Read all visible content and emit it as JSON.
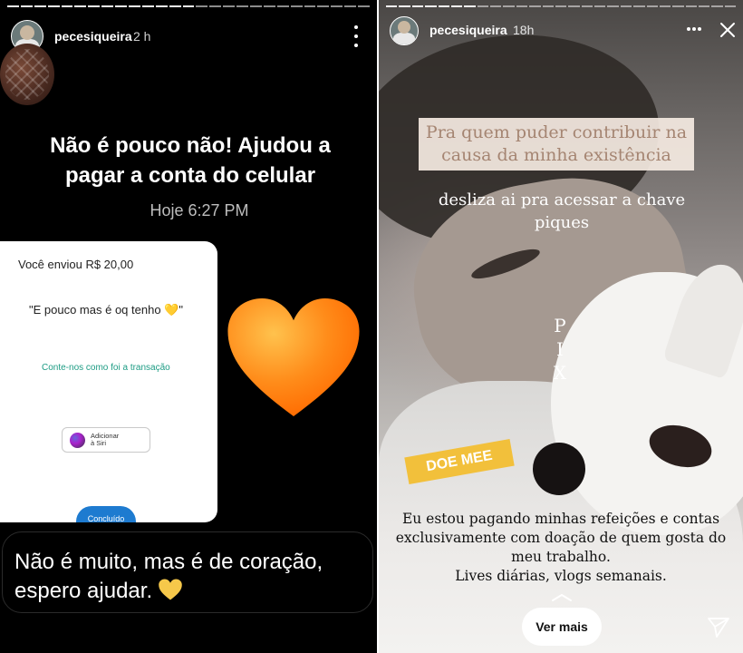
{
  "left_story": {
    "username": "pecesiqueira",
    "time": "2 h",
    "headline": "Não é pouco não! Ajudou a pagar a conta do celular",
    "date": "Hoje 6:27 PM",
    "receipt": {
      "sent": "Você enviou R$ 20,00",
      "message": "\"E pouco mas é oq tenho 💛\"",
      "link": "Conte-nos como foi a transação",
      "siri_label": "Adicionar\nà Siri",
      "done": "Concluído"
    },
    "caption": "Não é muito, mas é de coração, espero ajudar."
  },
  "right_story": {
    "username": "pecesiqueira",
    "time": "18h",
    "contribute_text": "Pra quem puder contribuir na causa da minha existência",
    "swipe_text": "desliza ai pra acessar a chave piques",
    "pix_letters": [
      "P",
      "I",
      "X"
    ],
    "donate_label": "DOE MEE",
    "bottom_lines": [
      "Eu estou pagando minhas refeições e contas",
      "exclusivamente com doação de quem gosta do",
      "meu trabalho.",
      "Lives diárias,  vlogs semanais."
    ],
    "see_more": "Ver mais"
  },
  "colors": {
    "heart_orange": "#ff8c1a",
    "heart_yellow": "#f6c84a",
    "donate_badge": "#f2c03b",
    "contribute_text": "#a58572"
  }
}
